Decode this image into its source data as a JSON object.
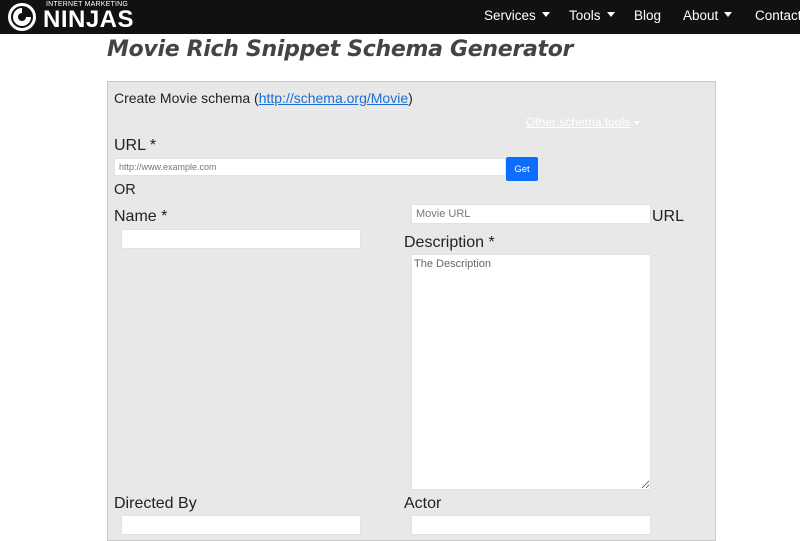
{
  "header": {
    "logo_tagline": "INTERNET MARKETING",
    "logo_brand": "NINJAS",
    "nav": [
      {
        "label": "Services",
        "dropdown": true
      },
      {
        "label": "Tools",
        "dropdown": true
      },
      {
        "label": "Blog",
        "dropdown": false
      },
      {
        "label": "About",
        "dropdown": true
      },
      {
        "label": "Contact",
        "dropdown": false
      }
    ]
  },
  "page": {
    "title": "Movie Rich Snippet Schema Generator"
  },
  "form": {
    "intro_text": "Create Movie schema (",
    "intro_link": "http://schema.org/Movie",
    "intro_close": ")",
    "other_tools": "Other schema tools",
    "url_label": "URL *",
    "url_placeholder": "http://www.example.com",
    "get_button": "Get",
    "or_label": "OR",
    "name_label": "Name *",
    "movie_url_placeholder": "Movie URL",
    "movie_url_suffix": "URL",
    "description_label": "Description *",
    "description_placeholder": "The Description",
    "directed_by_label": "Directed By",
    "actor_label": "Actor"
  },
  "colors": {
    "topbar": "#111111",
    "panel": "#e8e8e8",
    "link": "#1a6fd6",
    "button": "#0d6efd"
  }
}
